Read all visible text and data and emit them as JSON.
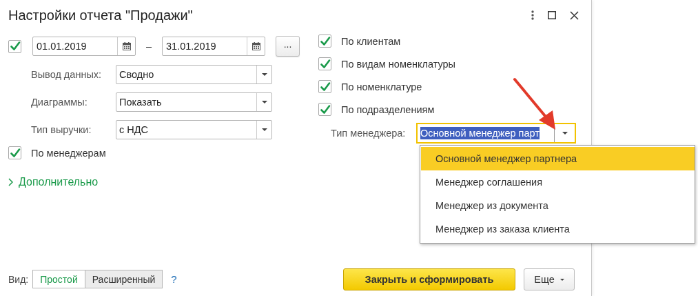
{
  "window": {
    "title": "Настройки отчета \"Продажи\""
  },
  "period": {
    "enabled": true,
    "start": "01.01.2019",
    "separator": "–",
    "end": "31.01.2019",
    "choose_button": "..."
  },
  "fields": [
    {
      "label": "Вывод данных:",
      "value": "Сводно"
    },
    {
      "label": "Диаграммы:",
      "value": "Показать"
    },
    {
      "label": "Тип выручки:",
      "value": "с НДС"
    }
  ],
  "by_managers": {
    "label": "По менеджерам",
    "checked": true
  },
  "more_section": {
    "label": "Дополнительно",
    "expanded": false
  },
  "groupings": [
    {
      "label": "По клиентам",
      "checked": true
    },
    {
      "label": "По видам номенклатуры",
      "checked": true
    },
    {
      "label": "По номенклатуре",
      "checked": true
    },
    {
      "label": "По подразделениям",
      "checked": true
    }
  ],
  "manager_type": {
    "label": "Тип менеджера:",
    "value": "Основной менеджер парт"
  },
  "dropdown": {
    "options": [
      {
        "label": "Основной менеджер партнера",
        "selected": true
      },
      {
        "label": "Менеджер соглашения",
        "selected": false
      },
      {
        "label": "Менеджер из документа",
        "selected": false
      },
      {
        "label": "Менеджер из заказа клиента",
        "selected": false
      }
    ]
  },
  "view": {
    "label": "Вид:",
    "options": [
      {
        "label": "Простой",
        "selected": true
      },
      {
        "label": "Расширенный",
        "selected": false
      }
    ],
    "help": "?"
  },
  "buttons": [
    {
      "label": "Закрыть и сформировать",
      "kind": "primary"
    },
    {
      "label": "Еще",
      "kind": "menu"
    }
  ]
}
